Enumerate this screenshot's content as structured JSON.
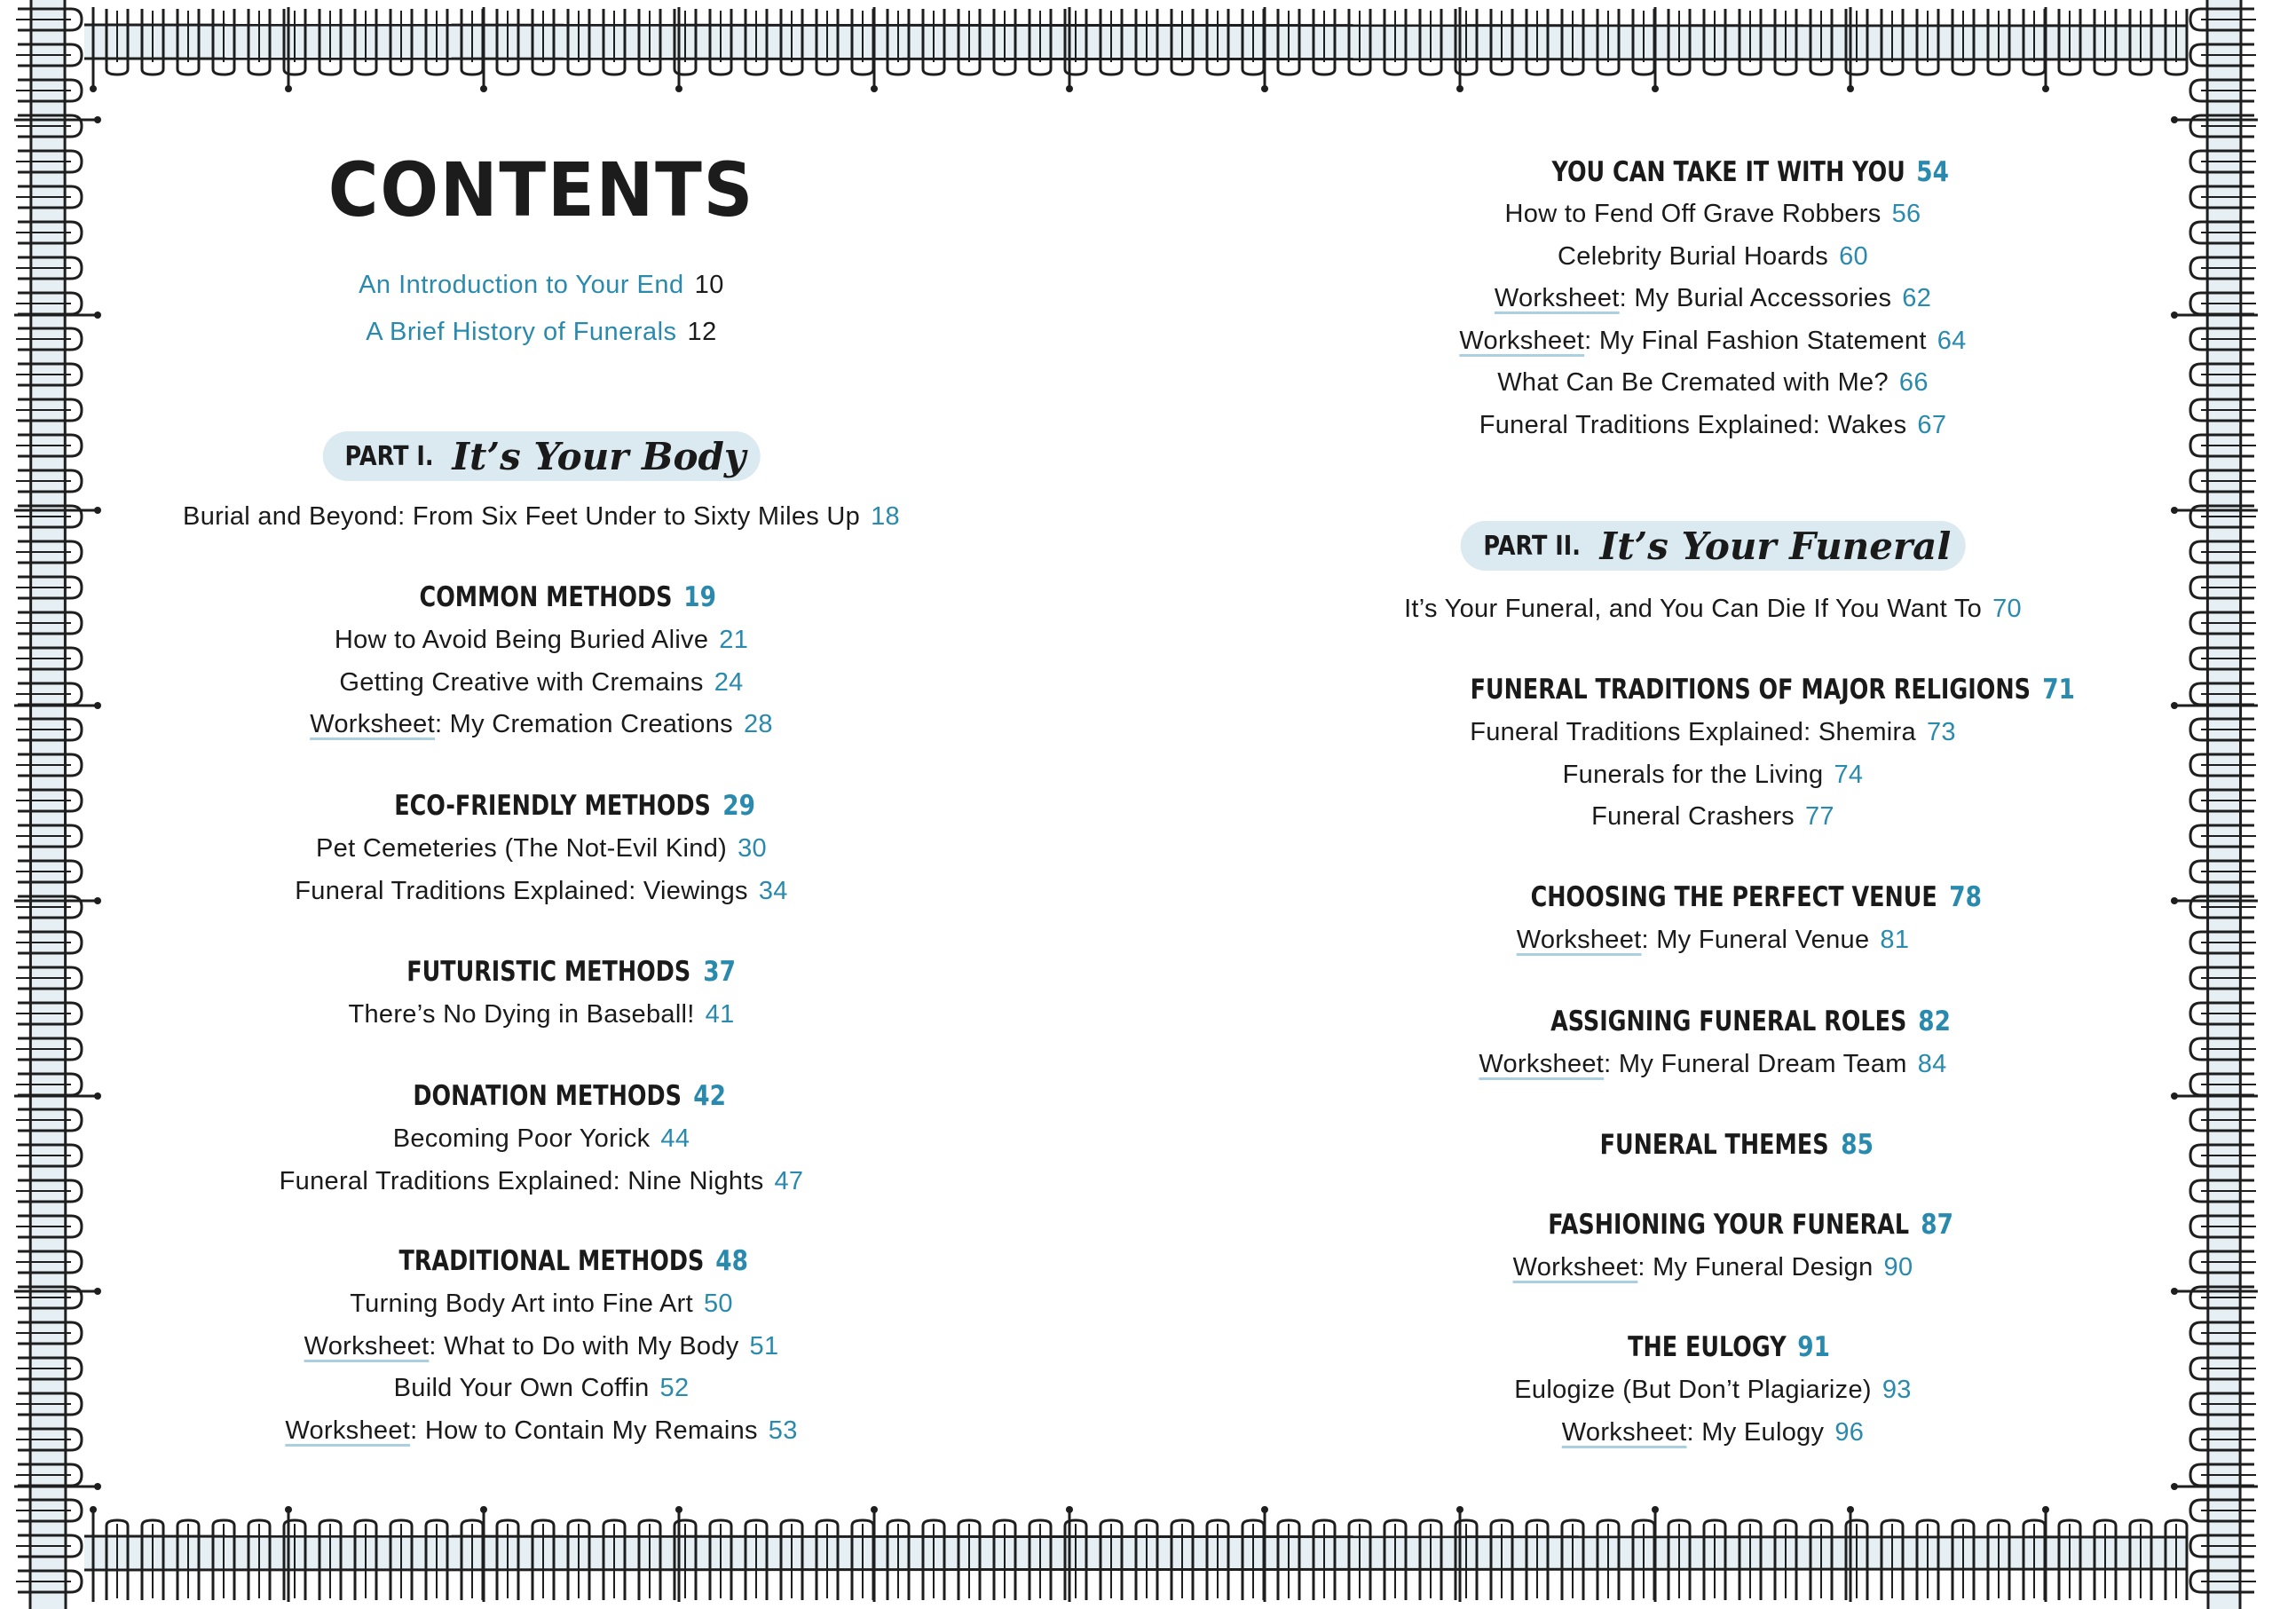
{
  "page": {
    "title": "CONTENTS",
    "accent_color": "#2a8aae",
    "pill_color": "#dbeaf1"
  },
  "intro_entries": [
    {
      "label": "An Introduction to Your End",
      "page": "10"
    },
    {
      "label": "A Brief History of Funerals",
      "page": "12"
    }
  ],
  "left": {
    "part": {
      "number": "PART I.",
      "title": "It’s Your Body"
    },
    "part_intro": {
      "label": "Burial and Beyond: From Six Feet Under to Sixty Miles Up",
      "page": "18"
    },
    "sections": [
      {
        "heading": "COMMON METHODS",
        "page": "19",
        "entries": [
          {
            "prefix": "",
            "label": "How to Avoid Being Buried Alive",
            "page": "21"
          },
          {
            "prefix": "",
            "label": "Getting Creative with Cremains",
            "page": "24"
          },
          {
            "prefix": "Worksheet",
            "label": ": My Cremation Creations",
            "page": "28"
          }
        ]
      },
      {
        "heading": "ECO-FRIENDLY METHODS",
        "page": "29",
        "entries": [
          {
            "prefix": "",
            "label": "Pet Cemeteries (The Not-Evil Kind)",
            "page": "30"
          },
          {
            "prefix": "",
            "label": "Funeral Traditions Explained: Viewings",
            "page": "34"
          }
        ]
      },
      {
        "heading": "FUTURISTIC METHODS",
        "page": "37",
        "entries": [
          {
            "prefix": "",
            "label": "There’s No Dying in Baseball!",
            "page": "41"
          }
        ]
      },
      {
        "heading": "DONATION METHODS",
        "page": "42",
        "entries": [
          {
            "prefix": "",
            "label": "Becoming Poor Yorick",
            "page": "44"
          },
          {
            "prefix": "",
            "label": "Funeral Traditions Explained: Nine Nights",
            "page": "47"
          }
        ]
      },
      {
        "heading": "TRADITIONAL METHODS",
        "page": "48",
        "entries": [
          {
            "prefix": "",
            "label": "Turning Body Art into Fine Art",
            "page": "50"
          },
          {
            "prefix": "Worksheet",
            "label": ": What to Do with My Body",
            "page": "51"
          },
          {
            "prefix": "",
            "label": "Build Your Own Coffin",
            "page": "52"
          },
          {
            "prefix": "Worksheet",
            "label": ": How to Contain My Remains",
            "page": "53"
          }
        ]
      }
    ]
  },
  "right": {
    "top_section": {
      "heading": "YOU CAN TAKE IT WITH YOU",
      "page": "54",
      "entries": [
        {
          "prefix": "",
          "label": "How to Fend Off Grave Robbers",
          "page": "56"
        },
        {
          "prefix": "",
          "label": "Celebrity Burial Hoards",
          "page": "60"
        },
        {
          "prefix": "Worksheet",
          "label": ": My Burial Accessories",
          "page": "62"
        },
        {
          "prefix": "Worksheet",
          "label": ": My Final Fashion Statement",
          "page": "64"
        },
        {
          "prefix": "",
          "label": "What Can Be Cremated with Me?",
          "page": "66"
        },
        {
          "prefix": "",
          "label": "Funeral Traditions Explained: Wakes",
          "page": "67"
        }
      ]
    },
    "part": {
      "number": "PART II.",
      "title": "It’s Your Funeral"
    },
    "part_intro": {
      "label": "It’s Your Funeral, and You Can Die If You Want To",
      "page": "70"
    },
    "sections": [
      {
        "heading": "FUNERAL TRADITIONS OF MAJOR RELIGIONS",
        "page": "71",
        "entries": [
          {
            "prefix": "",
            "label": "Funeral Traditions Explained: Shemira",
            "page": "73"
          },
          {
            "prefix": "",
            "label": "Funerals for the Living",
            "page": "74"
          },
          {
            "prefix": "",
            "label": "Funeral Crashers",
            "page": "77"
          }
        ]
      },
      {
        "heading": "CHOOSING THE PERFECT VENUE",
        "page": "78",
        "entries": [
          {
            "prefix": "Worksheet",
            "label": ": My Funeral Venue",
            "page": "81"
          }
        ]
      },
      {
        "heading": "ASSIGNING FUNERAL ROLES",
        "page": "82",
        "entries": [
          {
            "prefix": "Worksheet",
            "label": ": My Funeral Dream Team",
            "page": "84"
          }
        ]
      },
      {
        "heading": "FUNERAL THEMES",
        "page": "85",
        "entries": []
      },
      {
        "heading": "FASHIONING YOUR FUNERAL",
        "page": "87",
        "entries": [
          {
            "prefix": "Worksheet",
            "label": ": My Funeral Design",
            "page": "90"
          }
        ]
      },
      {
        "heading": "THE EULOGY",
        "page": "91",
        "entries": [
          {
            "prefix": "",
            "label": "Eulogize (But Don’t Plagiarize)",
            "page": "93"
          },
          {
            "prefix": "Worksheet",
            "label": ": My Eulogy",
            "page": "96"
          }
        ]
      }
    ]
  }
}
